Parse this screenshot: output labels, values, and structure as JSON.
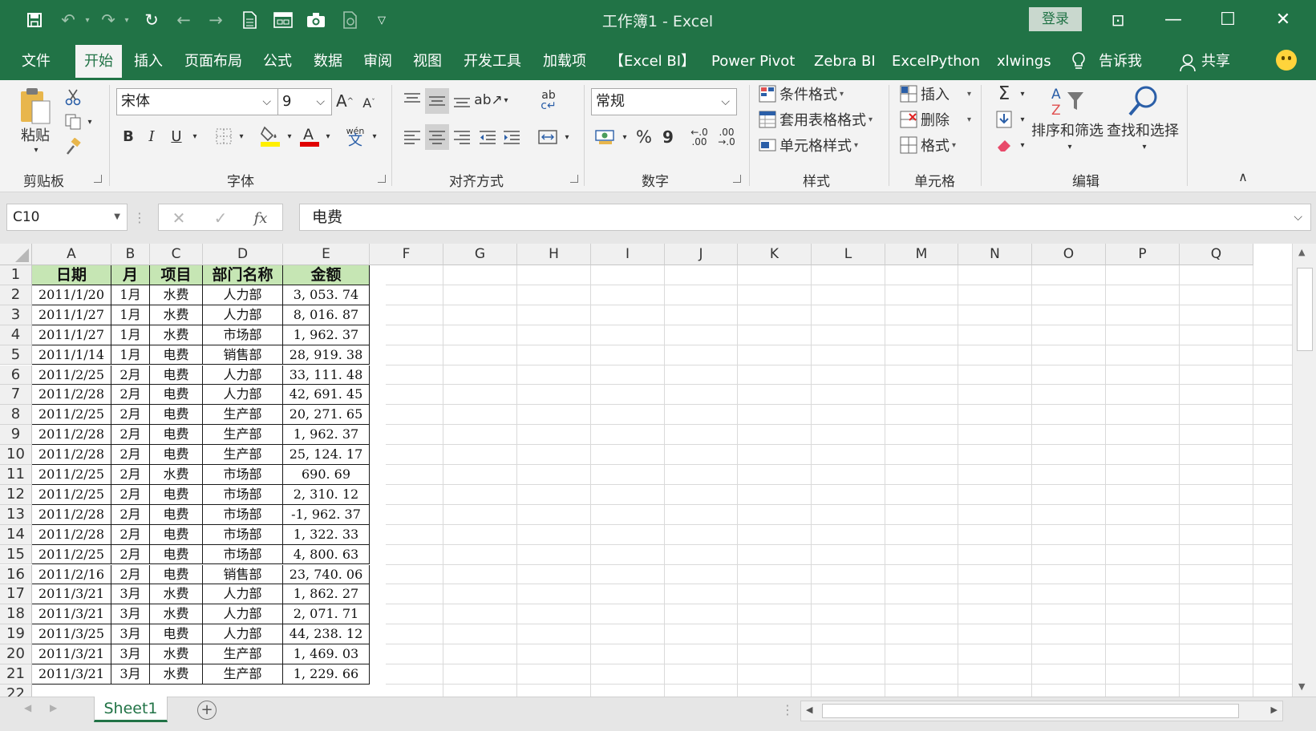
{
  "window": {
    "title": "工作簿1  -  Excel",
    "login": "登录",
    "controls": {
      "restore_ribbon": "⊡",
      "minimize": "—",
      "maximize": "☐",
      "close": "✕"
    }
  },
  "ribbon_tabs": [
    "文件",
    "开始",
    "插入",
    "页面布局",
    "公式",
    "数据",
    "审阅",
    "视图",
    "开发工具",
    "加载项",
    "【Excel BI】",
    "Power Pivot",
    "Zebra BI",
    "ExcelPython",
    "xlwings",
    "告诉我",
    "共享"
  ],
  "ribbon": {
    "clipboard": {
      "label": "剪贴板",
      "paste": "粘贴"
    },
    "font": {
      "label": "字体",
      "name": "宋体",
      "size": "9",
      "bold": "B",
      "italic": "I",
      "underline": "U",
      "phonetic": "wén"
    },
    "alignment": {
      "label": "对齐方式"
    },
    "number": {
      "label": "数字",
      "format": "常规",
      "percent": "%",
      "comma": "9"
    },
    "styles": {
      "label": "样式",
      "conditional": "条件格式",
      "table": "套用表格格式",
      "cell_styles": "单元格样式"
    },
    "cells": {
      "label": "单元格",
      "insert": "插入",
      "delete": "删除",
      "format": "格式"
    },
    "editing": {
      "label": "编辑",
      "sort_filter": "排序和筛选",
      "find_select": "查找和选择"
    }
  },
  "formula_bar": {
    "name_box": "C10",
    "value": "电费",
    "fx": "fx"
  },
  "columns": [
    "A",
    "B",
    "C",
    "D",
    "E",
    "F",
    "G",
    "H",
    "I",
    "J",
    "K",
    "L",
    "M",
    "N",
    "O",
    "P",
    "Q"
  ],
  "table": {
    "headers": [
      "日期",
      "月",
      "项目",
      "部门名称",
      "金额"
    ],
    "rows": [
      [
        "2011/1/20",
        "1月",
        "水费",
        "人力部",
        "3, 053. 74"
      ],
      [
        "2011/1/27",
        "1月",
        "水费",
        "人力部",
        "8, 016. 87"
      ],
      [
        "2011/1/27",
        "1月",
        "水费",
        "市场部",
        "1, 962. 37"
      ],
      [
        "2011/1/14",
        "1月",
        "电费",
        "销售部",
        "28, 919. 38"
      ],
      [
        "2011/2/25",
        "2月",
        "电费",
        "人力部",
        "33, 111. 48"
      ],
      [
        "2011/2/28",
        "2月",
        "电费",
        "人力部",
        "42, 691. 45"
      ],
      [
        "2011/2/25",
        "2月",
        "电费",
        "生产部",
        "20, 271. 65"
      ],
      [
        "2011/2/28",
        "2月",
        "电费",
        "生产部",
        "1, 962. 37"
      ],
      [
        "2011/2/28",
        "2月",
        "电费",
        "生产部",
        "25, 124. 17"
      ],
      [
        "2011/2/25",
        "2月",
        "水费",
        "市场部",
        "690. 69"
      ],
      [
        "2011/2/25",
        "2月",
        "电费",
        "市场部",
        "2, 310. 12"
      ],
      [
        "2011/2/28",
        "2月",
        "电费",
        "市场部",
        "-1, 962. 37"
      ],
      [
        "2011/2/28",
        "2月",
        "电费",
        "市场部",
        "1, 322. 33"
      ],
      [
        "2011/2/25",
        "2月",
        "电费",
        "市场部",
        "4, 800. 63"
      ],
      [
        "2011/2/16",
        "2月",
        "电费",
        "销售部",
        "23, 740. 06"
      ],
      [
        "2011/3/21",
        "3月",
        "水费",
        "人力部",
        "1, 862. 27"
      ],
      [
        "2011/3/21",
        "3月",
        "水费",
        "人力部",
        "2, 071. 71"
      ],
      [
        "2011/3/25",
        "3月",
        "电费",
        "人力部",
        "44, 238. 12"
      ],
      [
        "2011/3/21",
        "3月",
        "水费",
        "生产部",
        "1, 469. 03"
      ],
      [
        "2011/3/21",
        "3月",
        "水费",
        "生产部",
        "1, 229. 66"
      ]
    ]
  },
  "sheet_tabs": [
    "Sheet1"
  ],
  "colors": {
    "excel_green": "#217346",
    "header_fill": "#c6e6b4"
  }
}
